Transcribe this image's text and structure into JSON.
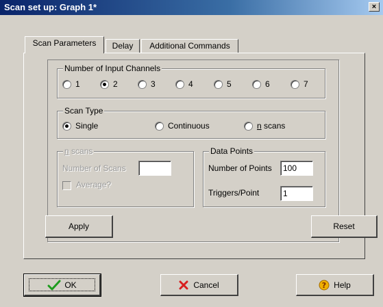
{
  "window": {
    "title": "Scan set up: Graph 1*",
    "close_glyph": "×"
  },
  "tabs": [
    {
      "label": "Scan Parameters"
    },
    {
      "label": "Delay"
    },
    {
      "label": "Additional Commands"
    }
  ],
  "input_channels": {
    "legend": "Number of Input Channels",
    "options": [
      "1",
      "2",
      "3",
      "4",
      "5",
      "6",
      "7"
    ],
    "selected": "2"
  },
  "scan_type": {
    "legend": "Scan Type",
    "options": [
      {
        "label": "Single",
        "selected": true
      },
      {
        "label": "Continuous",
        "selected": false
      },
      {
        "label": "n scans",
        "selected": false
      }
    ]
  },
  "n_scans": {
    "legend": "n scans",
    "number_label": "Number of Scans",
    "number_value": "",
    "average_label": "Average?",
    "average_checked": false
  },
  "data_points": {
    "legend": "Data Points",
    "points_label": "Number of Points",
    "points_value": "100",
    "triggers_label": "Triggers/Point",
    "triggers_value": "1"
  },
  "buttons": {
    "apply": "Apply",
    "reset": "Reset",
    "ok": "OK",
    "cancel": "Cancel",
    "help": "Help"
  },
  "colors": {
    "title_start": "#0a246a",
    "title_end": "#a6caf0",
    "face": "#d4d0c8",
    "ok_check": "#1e9c1e",
    "cancel_x": "#d81e1e",
    "help_icon": "#f0b000"
  },
  "icons": {
    "ok": "green-checkmark-icon",
    "cancel": "red-x-icon",
    "help": "question-mark-icon"
  }
}
